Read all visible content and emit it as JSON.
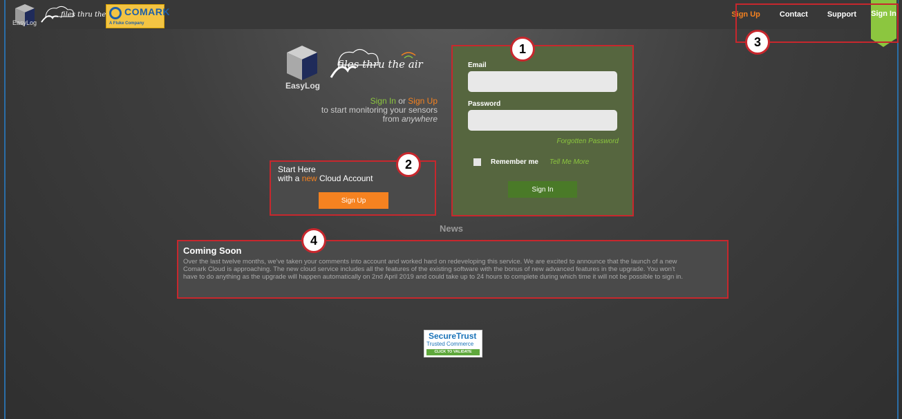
{
  "header": {
    "easylog_label": "EasyLog",
    "brand_tagline": "files thru the air",
    "comark_name": "COMARK",
    "comark_sub": "A Fluke Company"
  },
  "nav": {
    "sign_up": "Sign Up",
    "contact": "Contact",
    "support": "Support",
    "sign_in": "Sign In"
  },
  "hero": {
    "easylog_label": "EasyLog",
    "brand_tagline": "files thru the air",
    "sign_in": "Sign In",
    "or": " or ",
    "sign_up": "Sign Up",
    "line2": "to start monitoring your sensors",
    "line3_prefix": "from ",
    "line3_emph": "anywhere"
  },
  "login": {
    "email_label": "Email",
    "email_value": "",
    "password_label": "Password",
    "password_value": "",
    "forgot": "Forgotten Password",
    "remember": "Remember me",
    "tell_more": "Tell Me More",
    "submit": "Sign In"
  },
  "start": {
    "line1": "Start Here",
    "line2_prefix": "with a ",
    "line2_new": "new",
    "line2_suffix": " Cloud Account",
    "button": "Sign Up"
  },
  "news": {
    "heading": "News",
    "title": "Coming Soon",
    "body": "Over the last twelve months, we've taken your comments into account and worked hard on redeveloping this service. We are excited to announce that the launch of a new Comark Cloud is approaching. The new cloud service includes all the features of the existing software with the bonus of new advanced features in the upgrade. You won't have to do anything as the upgrade will happen automatically on 2nd April 2019 and could take up to 24 hours to complete during which time it will not be possible to sign in."
  },
  "trust": {
    "line1": "SecureTrust",
    "line2": "Trusted Commerce",
    "line3": "CLICK TO VALIDATE"
  },
  "annotations": {
    "a1": "1",
    "a2": "2",
    "a3": "3",
    "a4": "4"
  },
  "colors": {
    "accent_green": "#8cc63f",
    "accent_orange": "#f58220",
    "annotation_red": "#c8272d"
  }
}
